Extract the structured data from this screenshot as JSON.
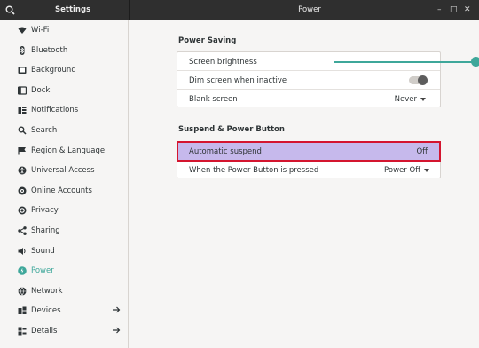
{
  "header": {
    "app_title": "Settings",
    "panel_title": "Power",
    "search_icon": "search-icon",
    "window_controls": [
      "–",
      "□",
      "✕"
    ]
  },
  "sidebar": {
    "items": [
      {
        "label": "Wi-Fi",
        "icon": "wifi-icon"
      },
      {
        "label": "Bluetooth",
        "icon": "bluetooth-icon"
      },
      {
        "label": "Background",
        "icon": "background-icon"
      },
      {
        "label": "Dock",
        "icon": "dock-icon"
      },
      {
        "label": "Notifications",
        "icon": "notifications-icon"
      },
      {
        "label": "Search",
        "icon": "search-icon"
      },
      {
        "label": "Region & Language",
        "icon": "region-icon"
      },
      {
        "label": "Universal Access",
        "icon": "accessibility-icon"
      },
      {
        "label": "Online Accounts",
        "icon": "online-accounts-icon"
      },
      {
        "label": "Privacy",
        "icon": "privacy-icon"
      },
      {
        "label": "Sharing",
        "icon": "sharing-icon"
      },
      {
        "label": "Sound",
        "icon": "sound-icon"
      },
      {
        "label": "Power",
        "icon": "power-icon",
        "active": true
      },
      {
        "label": "Network",
        "icon": "network-icon"
      },
      {
        "label": "Devices",
        "icon": "devices-icon",
        "has_submenu": true
      },
      {
        "label": "Details",
        "icon": "details-icon",
        "has_submenu": true
      }
    ]
  },
  "power_saving": {
    "title": "Power Saving",
    "screen_brightness": {
      "label": "Screen brightness",
      "level": 1.0
    },
    "dim_screen": {
      "label": "Dim screen when inactive",
      "enabled": false
    },
    "blank_screen": {
      "label": "Blank screen",
      "value": "Never"
    }
  },
  "suspend": {
    "title": "Suspend & Power Button",
    "automatic_suspend": {
      "label": "Automatic suspend",
      "value": "Off"
    },
    "power_button": {
      "label": "When the Power Button is pressed",
      "value": "Power Off"
    }
  },
  "colors": {
    "accent": "#3ea79a",
    "highlight_fill": "#c6b9ec",
    "highlight_border": "#d4152f",
    "headerbar": "#2f2f2f"
  }
}
